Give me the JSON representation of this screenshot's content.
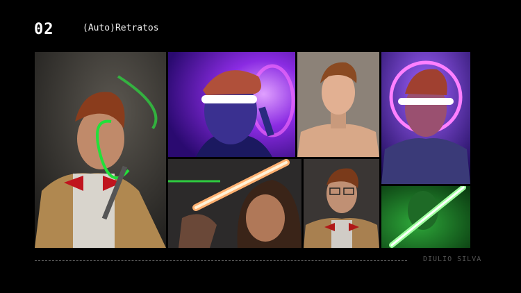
{
  "header": {
    "number": "02",
    "title": "(Auto)Retratos"
  },
  "footer": {
    "author": "DIULIO SILVA"
  },
  "colors": {
    "background": "#000000",
    "text": "#ffffff",
    "muted": "#555555"
  }
}
